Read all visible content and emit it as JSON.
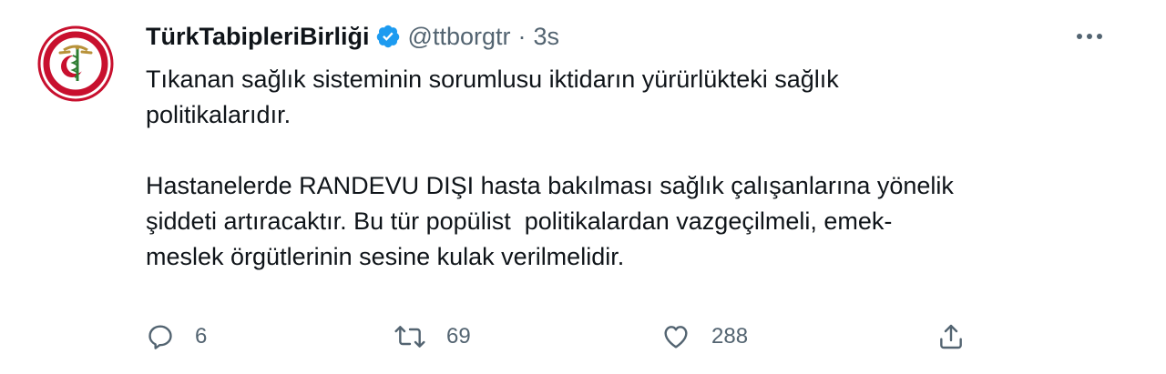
{
  "tweet": {
    "author": {
      "display_name": "TürkTabipleriBirliği",
      "handle": "@ttborgtr",
      "verified": true,
      "avatar_icon": "ttb-logo-icon"
    },
    "separator": "·",
    "time": "3s",
    "text": {
      "paragraph_1_line_1": "Tıkanan sağlık sisteminin sorumlusu iktidarın yürürlükteki sağlık",
      "paragraph_1_line_2": "politikalarıdır.",
      "paragraph_2_line_1": "Hastanelerde RANDEVU DIŞI hasta bakılması sağlık çalışanlarına yönelik",
      "paragraph_2_line_2": "şiddeti artıracaktır. Bu tür popülist  politikalardan vazgeçilmeli, emek-",
      "paragraph_2_line_3": "meslek örgütlerinin sesine kulak verilmelidir."
    },
    "actions": {
      "reply_count": "6",
      "retweet_count": "69",
      "like_count": "288"
    }
  },
  "colors": {
    "text": "#0f1419",
    "secondary": "#536471",
    "verified": "#1d9bf0",
    "logo_red": "#c8102e",
    "logo_gold": "#b8923a"
  }
}
